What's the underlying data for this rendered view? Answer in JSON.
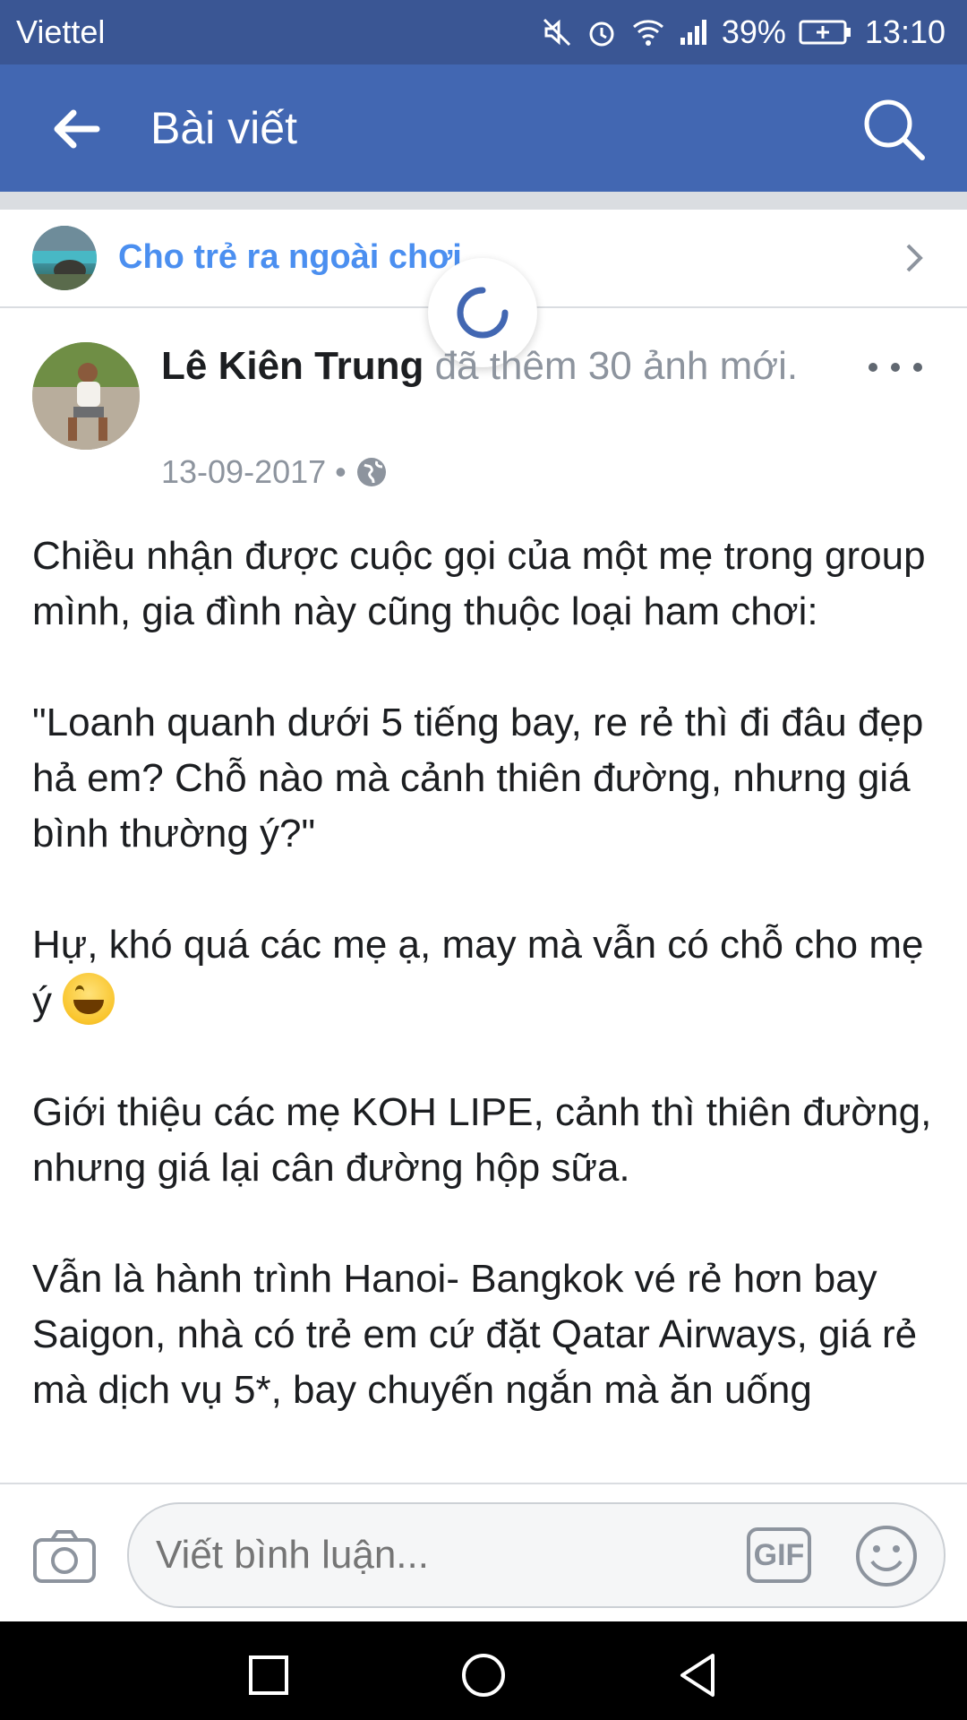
{
  "status_bar": {
    "carrier": "Viettel",
    "battery": "39%",
    "time": "13:10",
    "icons": [
      "mute-icon",
      "alarm-icon",
      "wifi-icon",
      "signal-icon",
      "battery-icon"
    ]
  },
  "app_bar": {
    "title": "Bài viết",
    "icons": [
      "back-arrow-icon",
      "search-icon"
    ]
  },
  "group": {
    "name": "Cho trẻ ra ngoài chơi"
  },
  "post": {
    "author": "Lê Kiên Trung",
    "action": " đã thêm 30 ảnh mới.",
    "date": "13-09-2017",
    "separator": "•",
    "privacy_icon": "globe-icon",
    "paragraphs": [
      "Chiều nhận được cuộc gọi của một mẹ trong group mình, gia đình này cũng thuộc loại ham chơi:",
      "\"Loanh quanh dưới 5 tiếng bay, re rẻ thì đi đâu đẹp hả em? Chỗ nào mà cảnh thiên đường, nhưng giá bình thường ý?\"",
      "Hự, khó quá các mẹ ạ, may mà vẫn có chỗ cho mẹ ý ",
      "Giới thiệu các mẹ KOH LIPE, cảnh thì thiên đường, nhưng giá lại cân đường hộp sữa.",
      "Vẫn là hành trình Hanoi- Bangkok vé rẻ hơn bay Saigon, nhà có trẻ em cứ đặt Qatar Airways, giá rẻ mà dịch vụ 5*, bay chuyến ngắn mà ăn uống"
    ]
  },
  "comment_bar": {
    "placeholder": "Viết bình luận...",
    "gif_label": "GIF"
  },
  "colors": {
    "status_bar": "#3a5694",
    "app_bar": "#4267b2",
    "group_link": "#4b8ff0",
    "spinner": "#4267b2"
  }
}
